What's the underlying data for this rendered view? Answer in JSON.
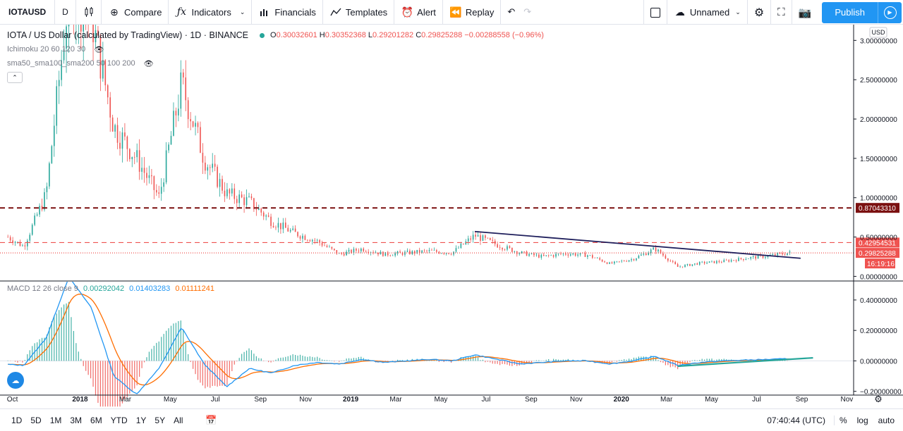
{
  "toolbar": {
    "symbol": "IOTAUSD",
    "interval": "D",
    "compare": "Compare",
    "indicators": "Indicators",
    "financials": "Financials",
    "templates": "Templates",
    "alert": "Alert",
    "replay": "Replay",
    "layout_name": "Unnamed",
    "publish": "Publish"
  },
  "legend": {
    "title": "IOTA / US Dollar (calculated by TradingView) · 1D · BINANCE",
    "open_label": "O",
    "open": "0.30032601",
    "high_label": "H",
    "high": "0.30352368",
    "low_label": "L",
    "low": "0.29201282",
    "close_label": "C",
    "close": "0.29825288",
    "change": "−0.00288558 (−0.96%)",
    "indicator1": "Ichimoku 20 60 120 30",
    "indicator2": "sma50_sma100_sma200 50 100 200"
  },
  "macd_legend": {
    "label": "MACD 12 26 close 9",
    "v1": "0.00292042",
    "v2": "0.01403283",
    "v3": "0.01111241"
  },
  "bottom": {
    "ranges": [
      "1D",
      "5D",
      "1M",
      "3M",
      "6M",
      "YTD",
      "1Y",
      "5Y",
      "All"
    ],
    "time": "07:40:44 (UTC)",
    "pct": "%",
    "log": "log",
    "auto": "auto"
  },
  "colors": {
    "up": "#26a69a",
    "down": "#ef5350",
    "macd_line": "#2196f3",
    "signal_line": "#ff6d00",
    "support_line": "#7b1010",
    "resistance_line": "#ef5350",
    "trend_line": "#1f1f5c"
  },
  "chart_data": [
    {
      "type": "candlestick",
      "title": "IOTA / US Dollar (calculated by TradingView) · 1D · BINANCE",
      "currency": "USD",
      "ylim": [
        -0.05,
        3.2
      ],
      "y_ticks": [
        "3.00000000",
        "2.50000000",
        "2.00000000",
        "1.50000000",
        "1.00000000",
        "0.50000000",
        "0.00000000"
      ],
      "x_ticks": [
        "Oct",
        "2018",
        "Mar",
        "May",
        "Jul",
        "Sep",
        "Nov",
        "2019",
        "Mar",
        "May",
        "Jul",
        "Sep",
        "Nov",
        "2020",
        "Mar",
        "May",
        "Jul",
        "Sep",
        "Nov"
      ],
      "horizontal_lines": [
        {
          "value": 0.8704331,
          "label": "0.87043310",
          "style": "dashed",
          "color": "#7b1010"
        },
        {
          "value": 0.42954531,
          "label": "0.42954531",
          "style": "dashed",
          "color": "#ef5350"
        },
        {
          "value": 0.29825288,
          "label": "0.29825288",
          "style": "dotted",
          "color": "#ef5350"
        }
      ],
      "countdown": "16:19:16",
      "trendline": {
        "from": {
          "date": "2019-06",
          "price": 0.57
        },
        "to": {
          "date": "2020-08",
          "price": 0.23
        }
      },
      "price_path": [
        [
          "2017-09",
          0.55
        ],
        [
          "2017-10",
          0.38
        ],
        [
          "2017-11",
          1.05
        ],
        [
          "2017-12",
          3.6
        ],
        [
          "2018-01",
          3.3
        ],
        [
          "2018-02",
          1.9
        ],
        [
          "2018-03",
          1.5
        ],
        [
          "2018-04",
          1.0
        ],
        [
          "2018-05",
          2.45
        ],
        [
          "2018-06",
          1.5
        ],
        [
          "2018-07",
          1.05
        ],
        [
          "2018-08",
          0.95
        ],
        [
          "2018-09",
          0.7
        ],
        [
          "2018-10",
          0.55
        ],
        [
          "2018-11",
          0.45
        ],
        [
          "2018-12",
          0.28
        ],
        [
          "2019-01",
          0.35
        ],
        [
          "2019-02",
          0.28
        ],
        [
          "2019-03",
          0.3
        ],
        [
          "2019-04",
          0.32
        ],
        [
          "2019-05",
          0.3
        ],
        [
          "2019-06",
          0.52
        ],
        [
          "2019-07",
          0.4
        ],
        [
          "2019-08",
          0.3
        ],
        [
          "2019-09",
          0.25
        ],
        [
          "2019-10",
          0.29
        ],
        [
          "2019-11",
          0.27
        ],
        [
          "2019-12",
          0.16
        ],
        [
          "2020-01",
          0.22
        ],
        [
          "2020-02",
          0.35
        ],
        [
          "2020-03",
          0.12
        ],
        [
          "2020-04",
          0.17
        ],
        [
          "2020-05",
          0.19
        ],
        [
          "2020-06",
          0.23
        ],
        [
          "2020-07",
          0.26
        ],
        [
          "2020-08",
          0.3
        ]
      ]
    },
    {
      "type": "histogram+line",
      "title": "MACD 12 26 close 9",
      "ylim": [
        -0.22,
        0.52
      ],
      "y_ticks": [
        "0.40000000",
        "0.20000000",
        "0.00000000",
        "−0.20000000"
      ],
      "series": [
        {
          "name": "MACD",
          "color": "#2196f3"
        },
        {
          "name": "Signal",
          "color": "#ff6d00"
        }
      ],
      "macd_path": [
        [
          "2017-09",
          -0.02
        ],
        [
          "2017-10",
          -0.03
        ],
        [
          "2017-11",
          0.15
        ],
        [
          "2017-12",
          0.55
        ],
        [
          "2018-01",
          0.35
        ],
        [
          "2018-02",
          -0.1
        ],
        [
          "2018-03",
          -0.22
        ],
        [
          "2018-04",
          -0.05
        ],
        [
          "2018-05",
          0.22
        ],
        [
          "2018-06",
          -0.02
        ],
        [
          "2018-07",
          -0.17
        ],
        [
          "2018-08",
          -0.05
        ],
        [
          "2018-09",
          -0.08
        ],
        [
          "2018-10",
          -0.03
        ],
        [
          "2018-11",
          -0.01
        ],
        [
          "2018-12",
          -0.02
        ],
        [
          "2019-01",
          0.01
        ],
        [
          "2019-02",
          -0.01
        ],
        [
          "2019-03",
          0.0
        ],
        [
          "2019-04",
          0.01
        ],
        [
          "2019-05",
          0.0
        ],
        [
          "2019-06",
          0.04
        ],
        [
          "2019-07",
          0.01
        ],
        [
          "2019-08",
          -0.02
        ],
        [
          "2019-09",
          -0.01
        ],
        [
          "2019-10",
          0.0
        ],
        [
          "2019-11",
          0.0
        ],
        [
          "2019-12",
          -0.02
        ],
        [
          "2020-01",
          0.0
        ],
        [
          "2020-02",
          0.03
        ],
        [
          "2020-03",
          -0.03
        ],
        [
          "2020-04",
          -0.01
        ],
        [
          "2020-05",
          0.0
        ],
        [
          "2020-06",
          0.005
        ],
        [
          "2020-07",
          0.01
        ],
        [
          "2020-08",
          0.014
        ]
      ],
      "trendline": {
        "from": {
          "date": "2020-03",
          "value": -0.035
        },
        "to": {
          "date": "2020-09",
          "value": 0.02
        }
      }
    }
  ]
}
